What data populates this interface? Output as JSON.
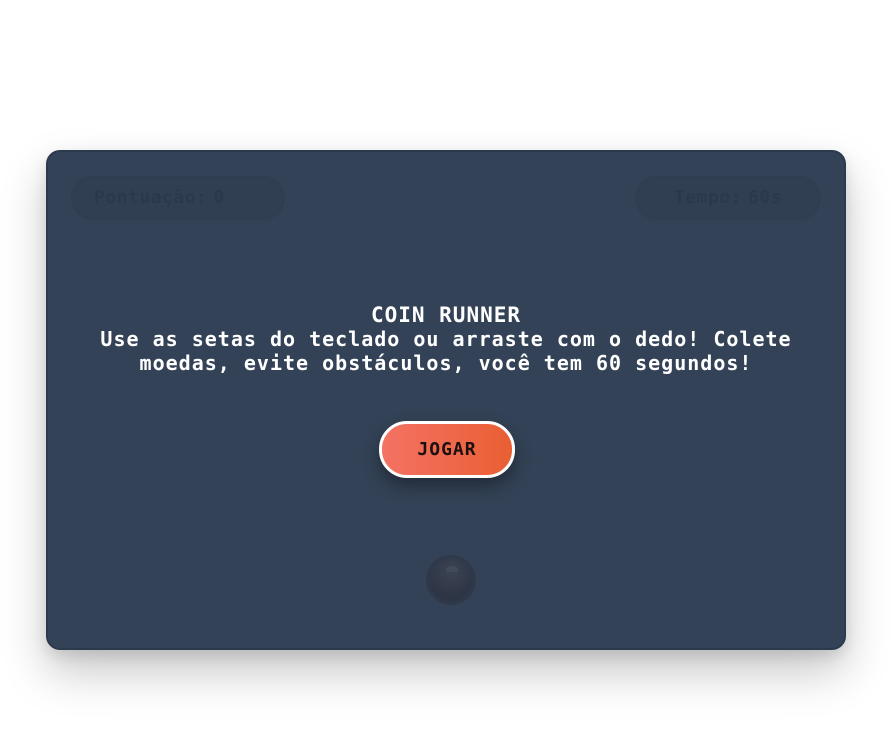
{
  "hud": {
    "score_label": "Pontuação:",
    "score_value": "0",
    "time_label": "Tempo:",
    "time_value": "60s"
  },
  "overlay": {
    "title": "COIN RUNNER",
    "instructions": "Use as setas do teclado ou arraste com o dedo! Colete moedas, evite obstáculos, você tem 60 segundos!",
    "play_label": "JOGAR"
  },
  "colors": {
    "board_background": "#334155",
    "button_gradient_start": "#f47264",
    "button_gradient_end": "#e95f33",
    "text": "#ffffff"
  },
  "icons": {
    "player": "player-ball-icon"
  }
}
